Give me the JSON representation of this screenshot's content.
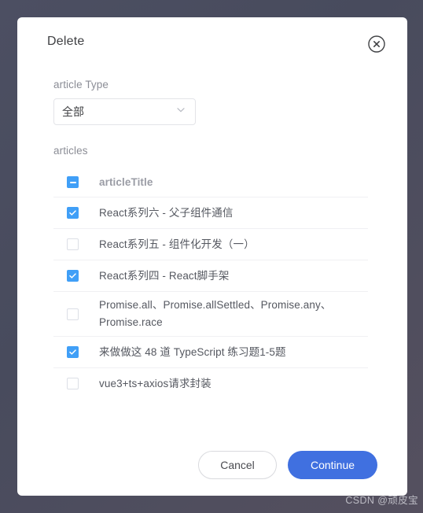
{
  "dialog": {
    "title": "Delete",
    "close_icon": "close-circle-icon"
  },
  "type_field": {
    "label": "article Type",
    "selected": "全部",
    "chevron_icon": "chevron-down-icon"
  },
  "articles_section": {
    "label": "articles",
    "column_header": "articleTitle",
    "header_checkbox_state": "indeterminate",
    "rows": [
      {
        "title": "React系列六 - 父子组件通信",
        "checked": true
      },
      {
        "title": "React系列五 - 组件化开发（一）",
        "checked": false
      },
      {
        "title": "React系列四 - React脚手架",
        "checked": true
      },
      {
        "title": "Promise.all、Promise.allSettled、Promise.any、Promise.race",
        "checked": false
      },
      {
        "title": "来做做这 48 道 TypeScript 练习题1-5题",
        "checked": true
      },
      {
        "title": "vue3+ts+axios请求封装",
        "checked": false
      }
    ]
  },
  "footer": {
    "cancel_label": "Cancel",
    "continue_label": "Continue"
  },
  "watermark": {
    "text": "CSDN @顽皮宝"
  },
  "colors": {
    "backdrop": "#4a4d60",
    "checkbox_blue": "#409ff7",
    "primary_button_blue": "#4070e0",
    "row_divider": "#f0f0f3",
    "label_gray": "#8b8d96",
    "title_gray": "#3f4043"
  }
}
